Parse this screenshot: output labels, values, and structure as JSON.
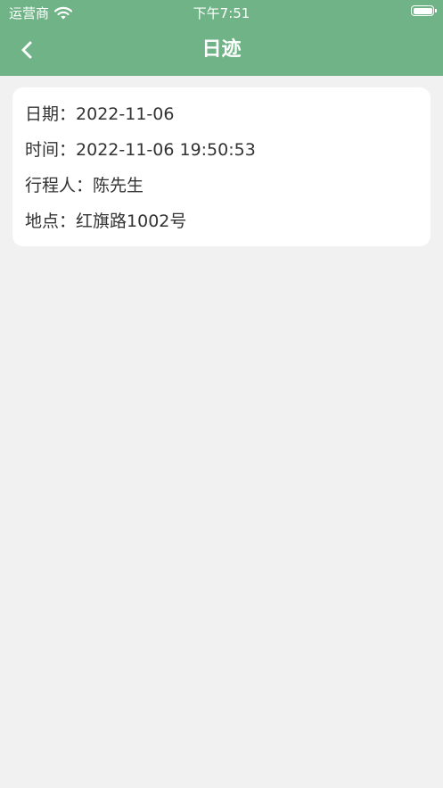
{
  "status_bar": {
    "carrier": "运营商",
    "time": "下午7:51"
  },
  "nav": {
    "title": "日迹"
  },
  "record": {
    "date_label": "日期：",
    "date_value": "2022-11-06",
    "time_label": "时间：",
    "time_value": "2022-11-06 19:50:53",
    "traveler_label": "行程人：",
    "traveler_value": "陈先生",
    "location_label": "地点：",
    "location_value": "红旗路1002号"
  },
  "colors": {
    "header": "#6fb387",
    "background": "#f1f1f1",
    "card": "#ffffff",
    "text": "#333333"
  }
}
